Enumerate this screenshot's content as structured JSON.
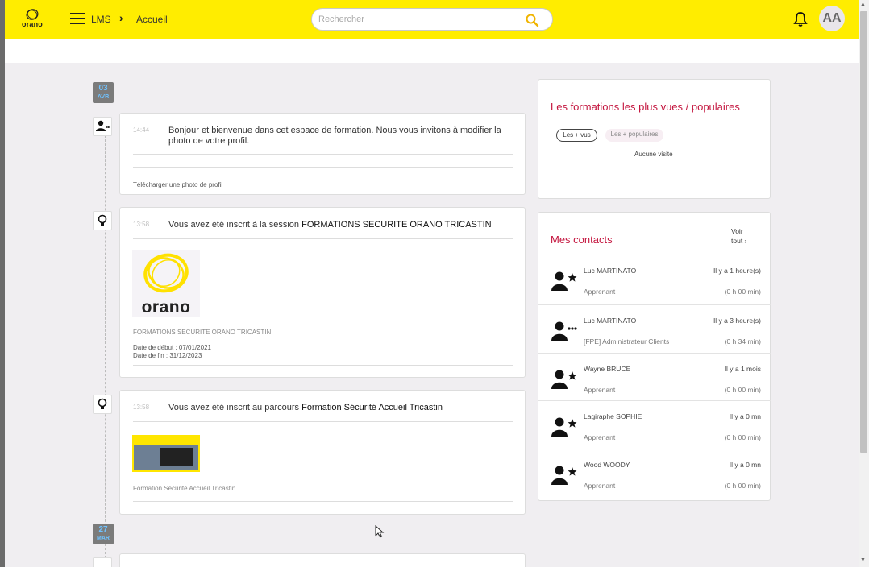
{
  "header": {
    "logo_text": "orano",
    "breadcrumb": [
      "LMS",
      "Accueil"
    ],
    "search_placeholder": "Rechercher",
    "avatar_initials": "AA"
  },
  "timeline": {
    "dates": [
      {
        "day": "03",
        "month": "AVR"
      },
      {
        "day": "27",
        "month": "MAR"
      }
    ],
    "items": [
      {
        "time": "14:44",
        "message": "Bonjour et bienvenue dans cet espace de formation. Nous vous invitons à modifier la photo de votre profil.",
        "action": "Télécharger une photo de profil"
      },
      {
        "time": "13:58",
        "message_prefix": "Vous avez été inscrit à la session ",
        "message_strong": "FORMATIONS SECURITE ORANO TRICASTIN",
        "image_logo_text": "orano",
        "caption": "FORMATIONS SECURITE ORANO TRICASTIN",
        "start_date": "Date de début : 07/01/2021",
        "end_date": "Date de fin : 31/12/2023"
      },
      {
        "time": "13:58",
        "message_prefix": "Vous avez été inscrit au parcours ",
        "message_strong": "Formation Sécurité Accueil Tricastin",
        "caption": "Formation Sécurité Accueil Tricastin"
      }
    ]
  },
  "popular": {
    "title": "Les formations les plus vues / populaires",
    "tabs": [
      "Les + vus",
      "Les + populaires"
    ],
    "empty_text": "Aucune visite"
  },
  "contacts": {
    "title": "Mes contacts",
    "see_all_line1": "Voir",
    "see_all_line2": "tout ›",
    "items": [
      {
        "name": "Luc MARTINATO",
        "time": "Il y a 1 heure(s)",
        "role": "Apprenant",
        "duration": "(0 h 00 min)",
        "icon": "user-star-icon"
      },
      {
        "name": "Luc MARTINATO",
        "time": "Il y a 3 heure(s)",
        "role": "[FPE] Administrateur Clients",
        "duration": "(0 h 34 min)",
        "icon": "user-dots-icon"
      },
      {
        "name": "Wayne BRUCE",
        "time": "Il y a 1 mois",
        "role": "Apprenant",
        "duration": "(0 h 00 min)",
        "icon": "user-star-icon"
      },
      {
        "name": "Lagiraphe SOPHIE",
        "time": "Il y a 0 mn",
        "role": "Apprenant",
        "duration": "(0 h 00 min)",
        "icon": "user-star-icon"
      },
      {
        "name": "Wood WOODY",
        "time": "Il y a 0 mn",
        "role": "Apprenant",
        "duration": "(0 h 00 min)",
        "icon": "user-star-icon"
      }
    ]
  },
  "colors": {
    "brand_yellow": "#ffed00",
    "accent_red": "#c4163f",
    "date_blue": "#6fc2ff"
  }
}
